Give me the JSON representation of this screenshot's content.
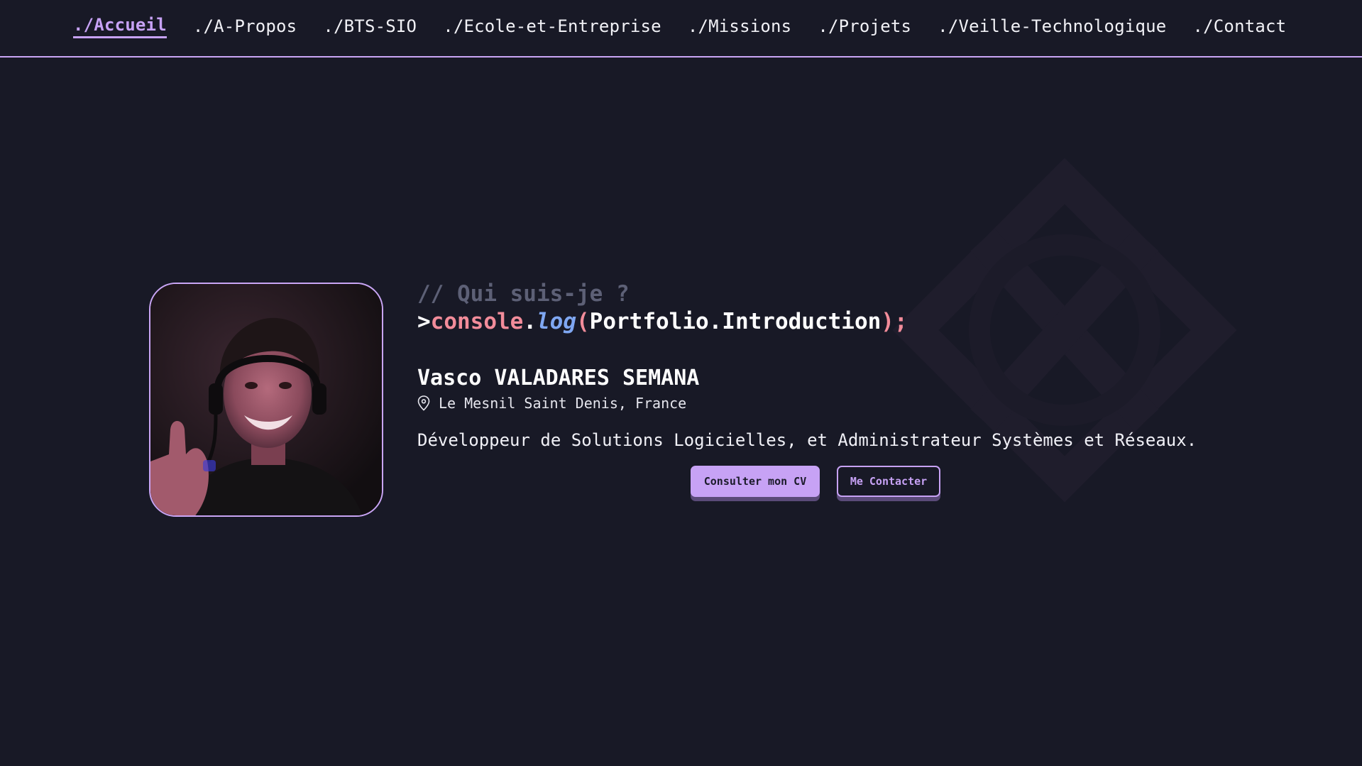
{
  "nav": {
    "items": [
      {
        "label": "./Accueil",
        "active": true
      },
      {
        "label": "./A-Propos",
        "active": false
      },
      {
        "label": "./BTS-SIO",
        "active": false
      },
      {
        "label": "./Ecole-et-Entreprise",
        "active": false
      },
      {
        "label": "./Missions",
        "active": false
      },
      {
        "label": "./Projets",
        "active": false
      },
      {
        "label": "./Veille-Technologique",
        "active": false
      },
      {
        "label": "./Contact",
        "active": false
      }
    ]
  },
  "hero": {
    "comment": "// Qui suis-je ?",
    "code": {
      "prompt": ">",
      "object": "console",
      "dot": ".",
      "method": "log",
      "open_paren": "(",
      "argument": "Portfolio.Introduction",
      "close": ");"
    },
    "name": "Vasco VALADARES SEMANA",
    "location": "Le Mesnil Saint Denis, France",
    "location_icon": "map-pin-icon",
    "tagline": "Développeur de Solutions Logicielles, et Administrateur Systèmes et Réseaux.",
    "buttons": {
      "cv_label": "Consulter mon CV",
      "contact_label": "Me Contacter"
    }
  },
  "colors": {
    "background": "#181926",
    "accent": "#c7a2f5",
    "comment": "#5d6076",
    "code_keyword": "#f28c9a",
    "code_method": "#7fa7f2"
  }
}
